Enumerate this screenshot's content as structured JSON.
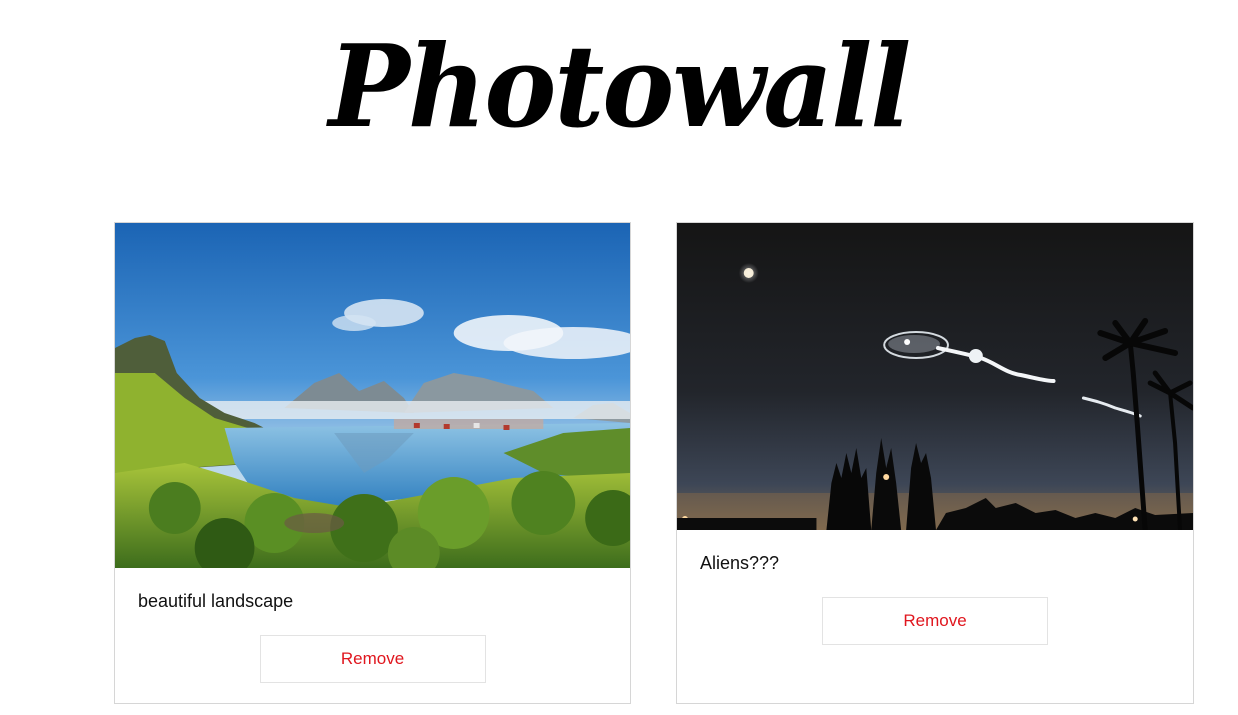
{
  "header": {
    "title": "Photowall"
  },
  "posts": [
    {
      "caption": "beautiful landscape",
      "remove_label": "Remove"
    },
    {
      "caption": "Aliens???",
      "remove_label": "Remove"
    }
  ],
  "colors": {
    "remove_text": "#e0161e",
    "card_border": "#d6d6d6"
  }
}
